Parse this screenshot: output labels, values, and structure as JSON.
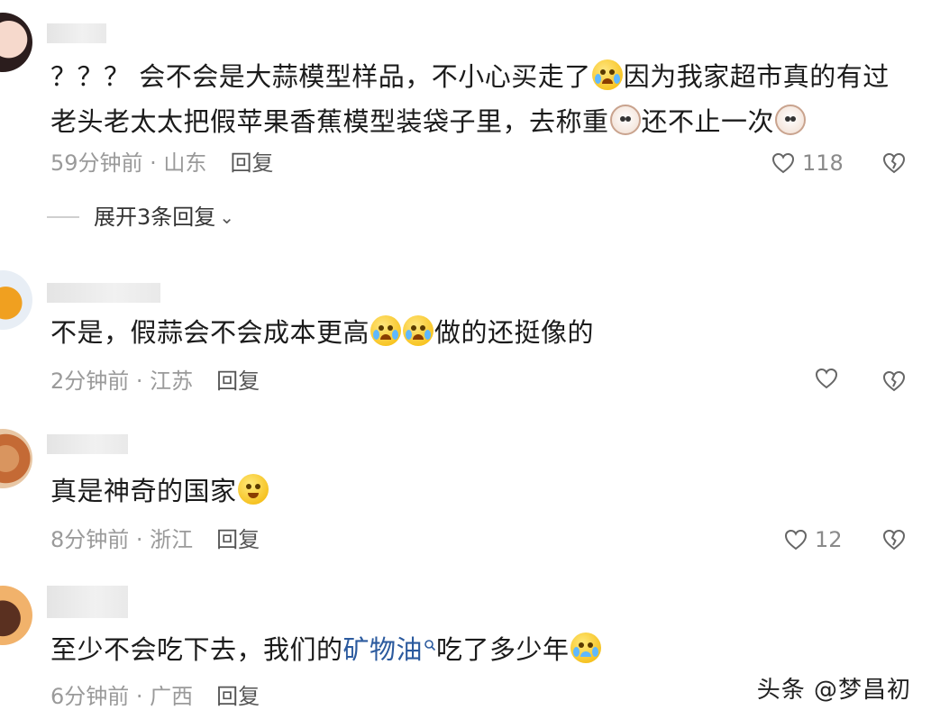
{
  "comments": [
    {
      "text_parts": [
        "？？？ 会不会是大蒜模型样品，不小心买走了",
        "因为我家超市真的有过老头老太太把假苹果香蕉模型装袋子里，去称重",
        "还不止一次"
      ],
      "time": "59分钟前 · 山东",
      "reply": "回复",
      "likes": "118",
      "expand": "展开3条回复"
    },
    {
      "text_parts": [
        "不是，假蒜会不会成本更高",
        "做的还挺像的"
      ],
      "time": "2分钟前 · 江苏",
      "reply": "回复",
      "likes": ""
    },
    {
      "text_parts": [
        "真是神奇的国家"
      ],
      "time": "8分钟前 · 浙江",
      "reply": "回复",
      "likes": "12"
    },
    {
      "text_parts": [
        "至少不会吃下去，我们的",
        "矿物油",
        "吃了多少年"
      ],
      "time": "6分钟前 · 广西",
      "reply": "回复",
      "likes": ""
    }
  ],
  "watermark": "头条 @梦昌初",
  "icons": {
    "like": "heart-outline-icon",
    "dislike": "broken-heart-icon",
    "search": "search-icon",
    "expand": "chevron-down-icon"
  },
  "colors": {
    "text": "#1b1b1b",
    "meta": "#9a9a9a",
    "link": "#2b5a9e"
  }
}
